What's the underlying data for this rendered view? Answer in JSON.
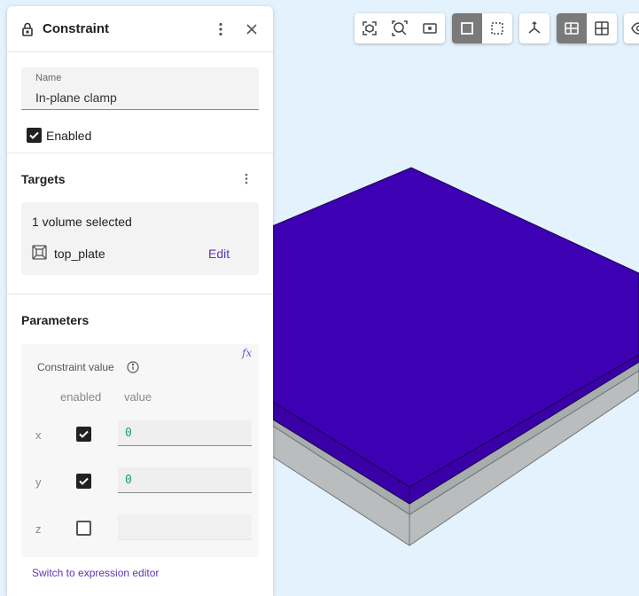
{
  "toolbar": {
    "group1": [
      "fit-selection-icon",
      "zoom-to-fit-icon",
      "zoom-box-icon"
    ],
    "group2": [
      "solid-view-icon",
      "wireframe-view-icon"
    ],
    "group3": [
      "axes-icon"
    ],
    "group4": [
      "section-view-icon",
      "grid-view-icon"
    ],
    "group5": [
      "eye-icon"
    ],
    "active_color": "#7a7a7a"
  },
  "panel": {
    "title": "Constraint",
    "name_label": "Name",
    "name_value": "In-plane clamp",
    "enabled_label": "Enabled",
    "enabled": true,
    "targets": {
      "title": "Targets",
      "count_text": "1 volume selected",
      "items": [
        {
          "name": "top_plate",
          "action": "Edit"
        }
      ]
    },
    "parameters": {
      "title": "Parameters",
      "fx_label": "fx",
      "constraint_value_label": "Constraint value",
      "columns": {
        "enabled": "enabled",
        "value": "value"
      },
      "rows": [
        {
          "axis": "x",
          "enabled": true,
          "value": "0"
        },
        {
          "axis": "y",
          "enabled": true,
          "value": "0"
        },
        {
          "axis": "z",
          "enabled": false,
          "value": ""
        }
      ],
      "switch_link": "Switch to expression editor"
    }
  },
  "colors": {
    "viewport_bg": "#e3f2fd",
    "plate_top": "#3d00b3",
    "plate_side": "#3a00a8",
    "base_plate": "#b0b5b5",
    "accent": "#5e35b1"
  }
}
